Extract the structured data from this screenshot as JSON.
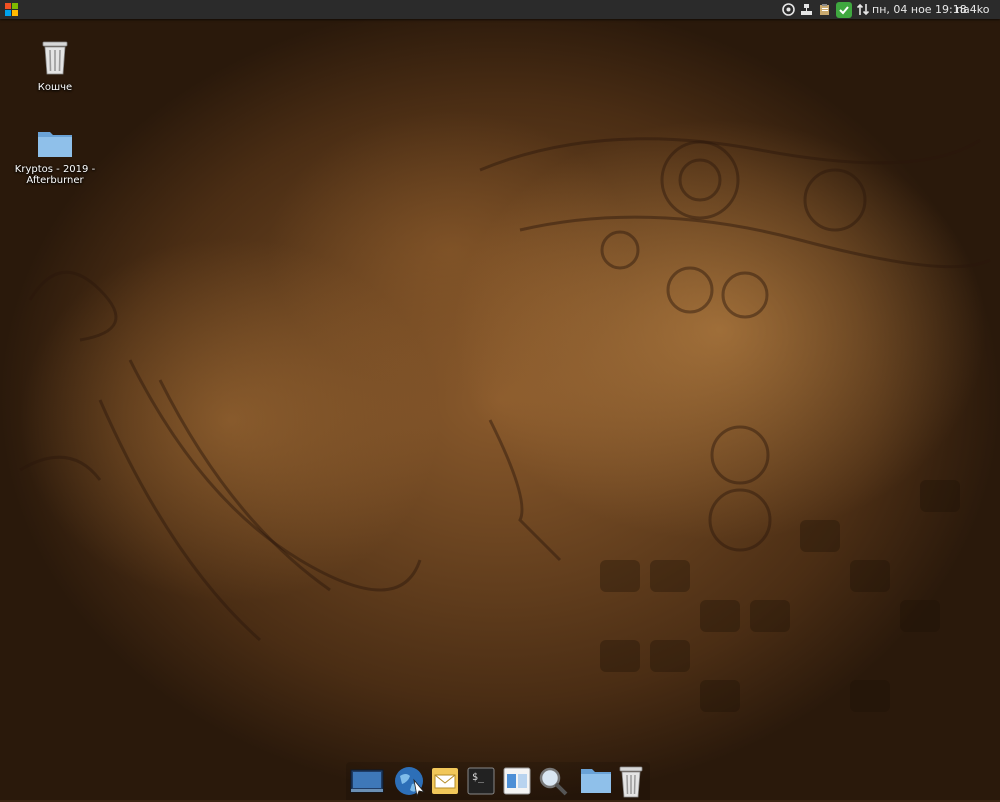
{
  "top_panel": {
    "menu_icon": "windows-logo-icon",
    "tray_icons": [
      "media-icon",
      "network-wired-icon",
      "clipboard-icon",
      "updates-ok-icon",
      "network-transfer-icon"
    ],
    "clock": "пн, 04 ное 19:18",
    "user": "na4ko"
  },
  "desktop": {
    "icons": [
      {
        "label": "Кошче",
        "icon": "trash-icon"
      },
      {
        "label": "Kryptos - 2019 - Afterburner",
        "icon": "folder-icon"
      }
    ]
  },
  "dock": {
    "items": [
      "show-desktop-icon",
      "web-browser-icon",
      "mail-icon",
      "terminal-icon",
      "workspace-switcher-icon",
      "search-icon",
      "file-manager-icon",
      "trash-icon"
    ]
  },
  "colors": {
    "panel_bg": "#2b2b2b",
    "panel_text": "#e6e6e6",
    "updates_ok": "#3fa83f",
    "folder_blue": "#7fb2e0"
  }
}
